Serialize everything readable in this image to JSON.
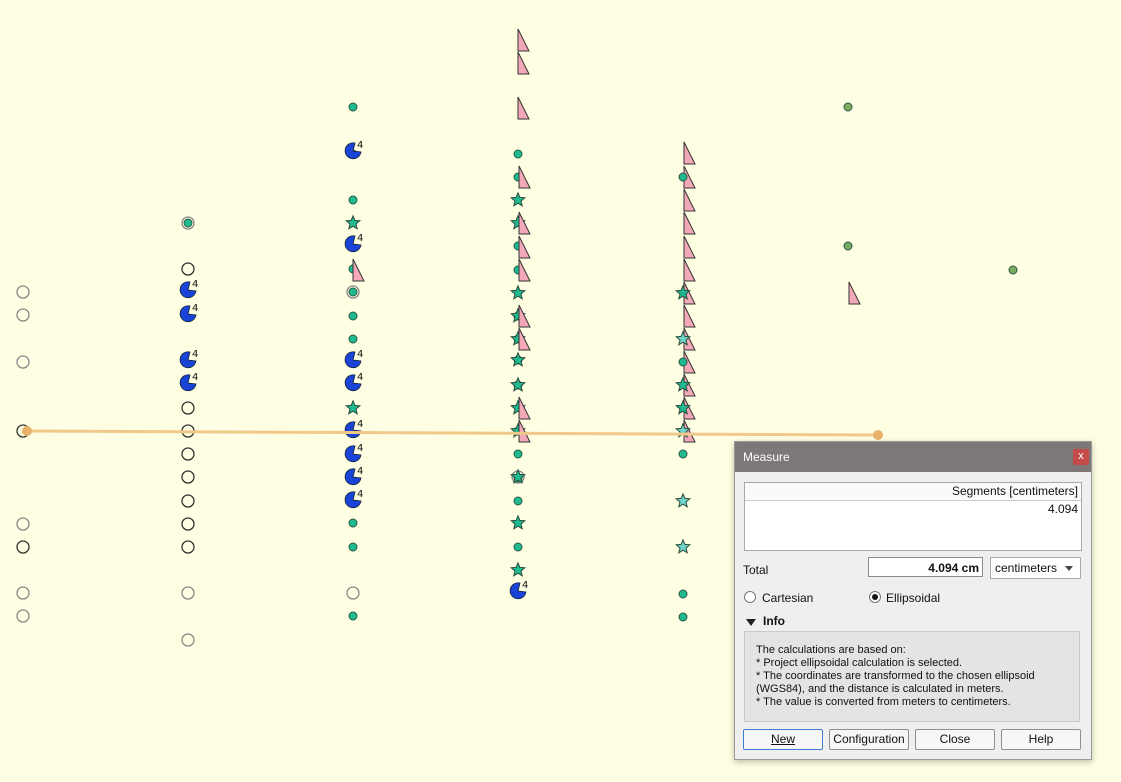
{
  "dialog": {
    "title": "Measure",
    "close_glyph": "x",
    "segments_header": "Segments [centimeters]",
    "segments": [
      "4.094"
    ],
    "total_label": "Total",
    "total_value": "4.094 cm",
    "unit_selected": "centimeters",
    "radio_cartesian": "Cartesian",
    "radio_ellipsoidal": "Ellipsoidal",
    "selected_mode": "Ellipsoidal",
    "info_title": "Info",
    "info_lines": [
      "The calculations are based on:",
      "* Project ellipsoidal calculation is selected.",
      "* The coordinates are transformed to the chosen ellipsoid",
      "(WGS84), and the distance is calculated in meters.",
      "* The value is converted from meters to centimeters."
    ],
    "buttons": {
      "new": "New",
      "configuration": "Configuration",
      "close": "Close",
      "help": "Help"
    }
  },
  "map": {
    "background": "#fefee2",
    "measure_line_color": "#f0c98a",
    "symbol_label": "4",
    "colors": {
      "teal": "#1fba8f",
      "blue": "#1a44d8",
      "pink": "#f3a8b8",
      "olive": "#7aab5f",
      "star_light": "#6fd3c8"
    }
  }
}
